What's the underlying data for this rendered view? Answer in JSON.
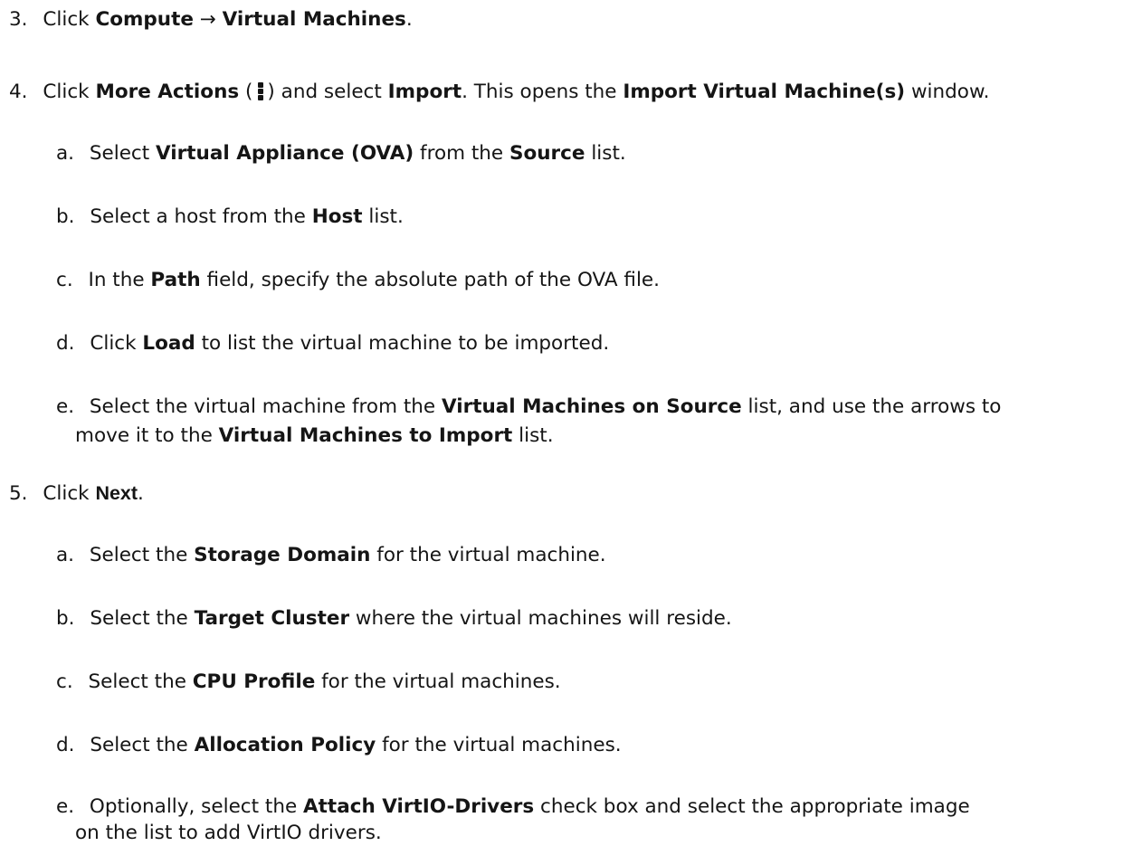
{
  "steps": [
    {
      "num": "3.",
      "parts": [
        "Click ",
        "Compute",
        " → ",
        "Virtual Machines",
        "."
      ]
    },
    {
      "num": "4.",
      "parts": [
        "Click ",
        "More Actions",
        " (",
        ") and select ",
        "Import",
        ". This opens the ",
        "Import Virtual Machine(s)",
        " window."
      ],
      "icon": "more-actions-kebab-icon",
      "substeps": [
        {
          "letter": "a.",
          "parts": [
            "Select ",
            "Virtual Appliance (OVA)",
            " from the ",
            "Source",
            " list."
          ]
        },
        {
          "letter": "b.",
          "parts": [
            "Select a host from the ",
            "Host",
            " list."
          ]
        },
        {
          "letter": "c.",
          "parts": [
            "In the ",
            "Path",
            " field, specify the absolute path of the OVA file."
          ]
        },
        {
          "letter": "d.",
          "parts": [
            "Click ",
            "Load",
            " to list the virtual machine to be imported."
          ]
        },
        {
          "letter": "e.",
          "parts": [
            "Select the virtual machine from the ",
            "Virtual Machines on Source",
            " list, and use the arrows to",
            "move it to the ",
            "Virtual Machines to Import",
            " list."
          ]
        }
      ]
    },
    {
      "num": "5.",
      "parts": [
        "Click ",
        "Next",
        "."
      ],
      "substeps": [
        {
          "letter": "a.",
          "parts": [
            "Select the ",
            "Storage Domain",
            " for the virtual machine."
          ]
        },
        {
          "letter": "b.",
          "parts": [
            "Select the ",
            "Target Cluster",
            " where the virtual machines will reside."
          ]
        },
        {
          "letter": "c.",
          "parts": [
            "Select the ",
            "CPU Profile",
            " for the virtual machines."
          ]
        },
        {
          "letter": "d.",
          "parts": [
            "Select the ",
            "Allocation Policy",
            " for the virtual machines."
          ]
        },
        {
          "letter": "e.",
          "parts": [
            "Optionally, select the ",
            "Attach VirtIO-Drivers",
            " check box and select the appropriate image",
            "on the list to add VirtIO drivers."
          ]
        }
      ]
    }
  ]
}
